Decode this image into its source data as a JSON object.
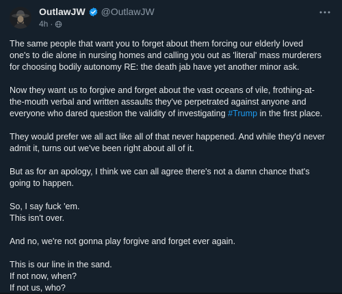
{
  "author": {
    "display_name": "OutlawJW",
    "handle": "@OutlawJW",
    "time": "4h",
    "separator": "·"
  },
  "icons": {
    "avatar": "avatar-cowboy",
    "verified": "verified-badge-icon",
    "visibility": "globe-icon",
    "more": "more-horizontal-icon"
  },
  "colors": {
    "background": "#15202b",
    "text": "#e7e9ea",
    "secondary": "#8b98a5",
    "accent": "#1d9bf0"
  },
  "post": {
    "p1": {
      "l1": "The same people that want you to forget about them forcing our elderly loved",
      "l2": "one's to die alone in nursing homes and calling you out as 'literal' mass murderers",
      "l3": "for choosing bodily autonomy RE: the death jab have yet another minor ask."
    },
    "p2": {
      "l1": "Now they want us to forgive and forget about the vast oceans of vile, frothing-at-",
      "l2": "the-mouth verbal and written assaults they've perpetrated against anyone and",
      "l3_before": "everyone who dared question the validity of investigating ",
      "hashtag": "#Trump",
      "l3_after": " in the first place."
    },
    "p3": {
      "l1": "They would prefer we all act like all of that never happened. And while they'd never",
      "l2": "admit it, turns out we've been right about all of it."
    },
    "p4": {
      "l1": "But as for an apology, I think we can all agree there's not a damn chance that's",
      "l2": "going to happen."
    },
    "p5": {
      "l1": "So, I say fuck 'em.",
      "l2": "This isn't over."
    },
    "p6": {
      "l1": "And no, we're not gonna play forgive and forget ever again."
    },
    "p7": {
      "l1": "This is our line in the sand.",
      "l2": "If not now, when?",
      "l3": "If not us, who?"
    }
  }
}
